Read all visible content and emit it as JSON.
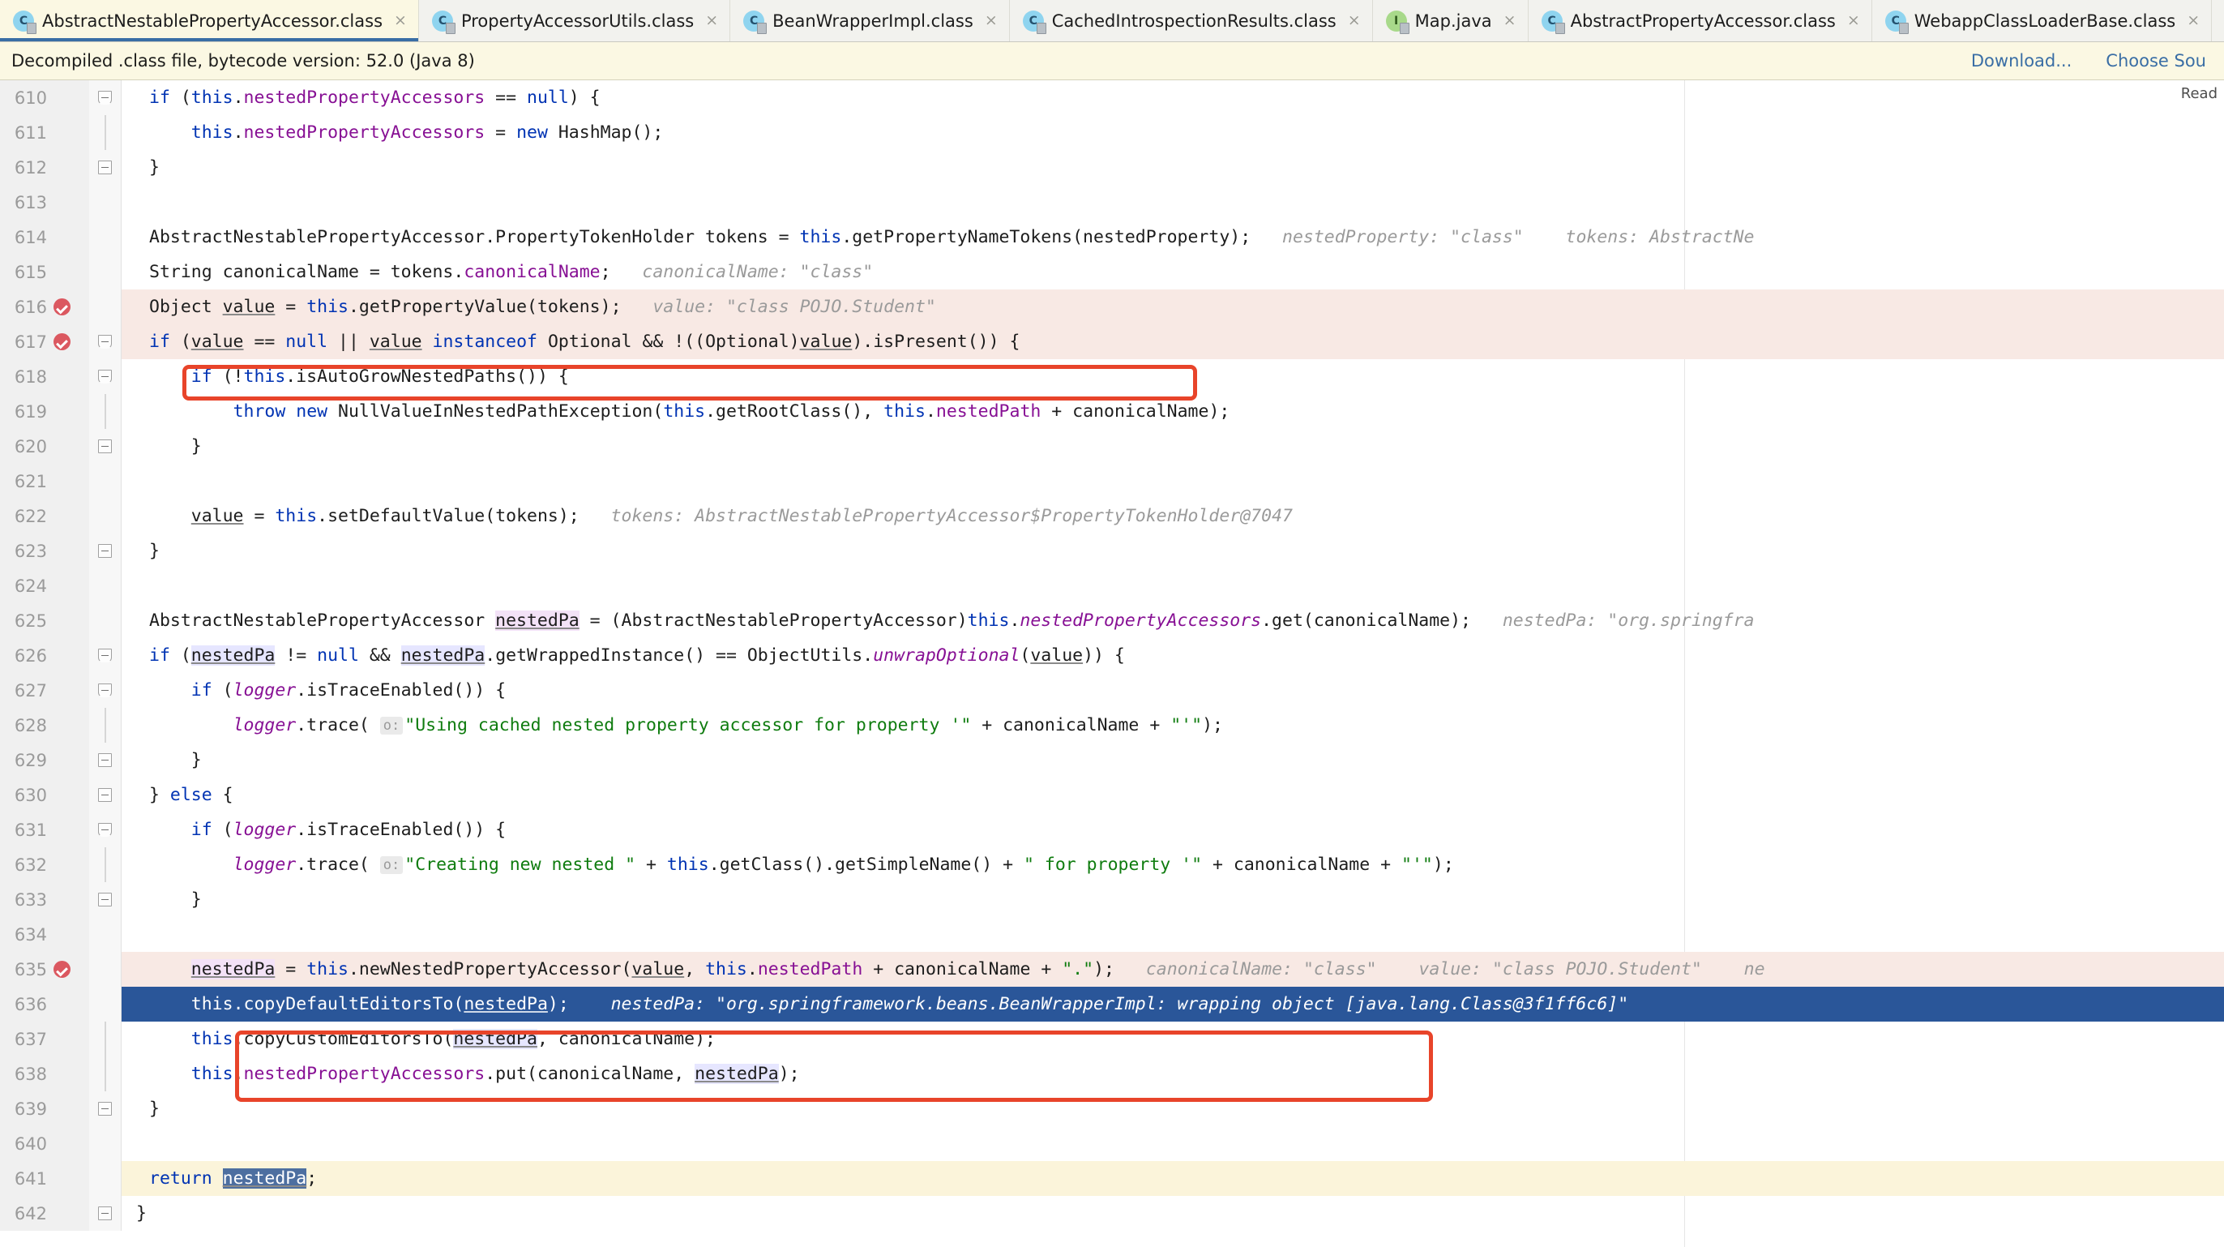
{
  "tabs": [
    {
      "label": "AbstractNestablePropertyAccessor.class",
      "icon": "class-icon",
      "kind": "class",
      "active": true,
      "close": "×"
    },
    {
      "label": "PropertyAccessorUtils.class",
      "icon": "class-icon",
      "kind": "class",
      "active": false,
      "close": "×"
    },
    {
      "label": "BeanWrapperImpl.class",
      "icon": "class-icon",
      "kind": "class",
      "active": false,
      "close": "×"
    },
    {
      "label": "CachedIntrospectionResults.class",
      "icon": "class-icon",
      "kind": "class",
      "active": false,
      "close": "×"
    },
    {
      "label": "Map.java",
      "icon": "interface-icon",
      "kind": "interface",
      "active": false,
      "close": "×"
    },
    {
      "label": "AbstractPropertyAccessor.class",
      "icon": "class-icon",
      "kind": "class",
      "active": false,
      "close": "×"
    },
    {
      "label": "WebappClassLoaderBase.class",
      "icon": "class-icon",
      "kind": "class",
      "active": false,
      "close": "×"
    }
  ],
  "infobar": {
    "message": "Decompiled .class file, bytecode version: 52.0 (Java 8)",
    "download_label": "Download...",
    "choose_sources_label": "Choose Sou"
  },
  "editor": {
    "readonly_label": "Read",
    "colors": {
      "keyword": "#0033b3",
      "field": "#871094",
      "string": "#0f7c0f",
      "number": "#1750eb",
      "hint": "#9a9a9a",
      "selection": "#2a5699",
      "exec_line": "#fbf4da",
      "breakpoint_line": "#f8e9e4",
      "annotation": "#e8442a"
    },
    "lines": [
      {
        "no": "610"
      },
      {
        "no": "611"
      },
      {
        "no": "612"
      },
      {
        "no": "613"
      },
      {
        "no": "614"
      },
      {
        "no": "615"
      },
      {
        "no": "616"
      },
      {
        "no": "617"
      },
      {
        "no": "618"
      },
      {
        "no": "619"
      },
      {
        "no": "620"
      },
      {
        "no": "621"
      },
      {
        "no": "622"
      },
      {
        "no": "623"
      },
      {
        "no": "624"
      },
      {
        "no": "625"
      },
      {
        "no": "626"
      },
      {
        "no": "627"
      },
      {
        "no": "628"
      },
      {
        "no": "629"
      },
      {
        "no": "630"
      },
      {
        "no": "631"
      },
      {
        "no": "632"
      },
      {
        "no": "633"
      },
      {
        "no": "634"
      },
      {
        "no": "635"
      },
      {
        "no": "636"
      },
      {
        "no": "637"
      },
      {
        "no": "638"
      },
      {
        "no": "639"
      },
      {
        "no": "640"
      },
      {
        "no": "641"
      },
      {
        "no": "642"
      }
    ],
    "code": {
      "l610": "if (this.nestedPropertyAccessors == null) {",
      "l611": "this.nestedPropertyAccessors = new HashMap();",
      "l612": "}",
      "l614": "AbstractNestablePropertyAccessor.PropertyTokenHolder tokens = this.getPropertyNameTokens(nestedProperty);",
      "l614_hint1": "nestedProperty: \"class\"",
      "l614_hint2": "tokens: AbstractNe",
      "l615": "String canonicalName = tokens.canonicalName;",
      "l615_hint": "canonicalName: \"class\"",
      "l616": "Object value = this.getPropertyValue(tokens);",
      "l616_hint": "value: \"class POJO.Student\"",
      "l617": "if (value == null || value instanceof Optional && !((Optional)value).isPresent()) {",
      "l618": "if (!this.isAutoGrowNestedPaths()) {",
      "l619": "throw new NullValueInNestedPathException(this.getRootClass(), this.nestedPath + canonicalName);",
      "l620": "}",
      "l622": "value = this.setDefaultValue(tokens);",
      "l622_hint": "tokens: AbstractNestablePropertyAccessor$PropertyTokenHolder@7047",
      "l623": "}",
      "l625": "AbstractNestablePropertyAccessor nestedPa = (AbstractNestablePropertyAccessor)this.nestedPropertyAccessors.get(canonicalName);",
      "l625_hint": "nestedPa: \"org.springfra",
      "l626": "if (nestedPa != null && nestedPa.getWrappedInstance() == ObjectUtils.unwrapOptional(value)) {",
      "l627": "if (logger.isTraceEnabled()) {",
      "l628": "logger.trace( o: \"Using cached nested property accessor for property '\" + canonicalName + \"'\");",
      "l629": "}",
      "l630": "} else {",
      "l631": "if (logger.isTraceEnabled()) {",
      "l632": "logger.trace( o: \"Creating new nested \" + this.getClass().getSimpleName() + \" for property '\" + canonicalName + \"'\");",
      "l633": "}",
      "l635": "nestedPa = this.newNestedPropertyAccessor(value, this.nestedPath + canonicalName + \".\");",
      "l635_hint1": "canonicalName: \"class\"",
      "l635_hint2": "value: \"class POJO.Student\"",
      "l635_hint3": "ne",
      "l636": "this.copyDefaultEditorsTo(nestedPa);",
      "l636_hint": "nestedPa: \"org.springframework.beans.BeanWrapperImpl: wrapping object [java.lang.Class@3f1ff6c6]\"",
      "l637": "this.copyCustomEditorsTo(nestedPa, canonicalName);",
      "l638": "this.nestedPropertyAccessors.put(canonicalName, nestedPa);",
      "l639": "}",
      "l641": "return nestedPa;",
      "l642": "}"
    },
    "param_badge": "o:",
    "breakpoint_lines": [
      "616",
      "617",
      "635"
    ],
    "selected_line": "636",
    "execution_line": "641"
  }
}
